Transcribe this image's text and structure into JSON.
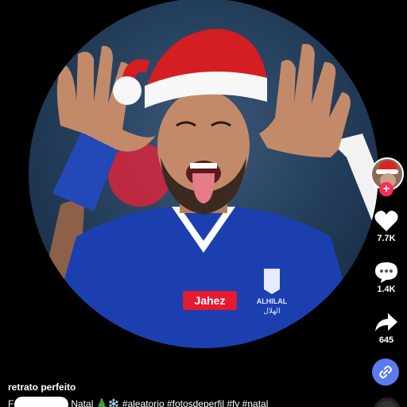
{
  "post": {
    "title": "retrato perfeito",
    "caption_start": "F",
    "caption_rest": "Natal 🎄❄️ #aleatorio #fotosdeperfil #fy #natal"
  },
  "image": {
    "jersey_sponsor": "Jahez",
    "club_text": "ALHILAL",
    "club_text_ar": "الهلال"
  },
  "actions": {
    "likes": "7.7K",
    "comments": "1.4K",
    "shares": "645"
  },
  "icons": {
    "follow": "+",
    "like": "heart-icon",
    "comment": "comment-icon",
    "share": "share-icon",
    "link": "link-icon"
  },
  "colors": {
    "accent": "#fe2c55",
    "link_button": "#5b7cf0",
    "jersey": "#1c3fb0"
  }
}
